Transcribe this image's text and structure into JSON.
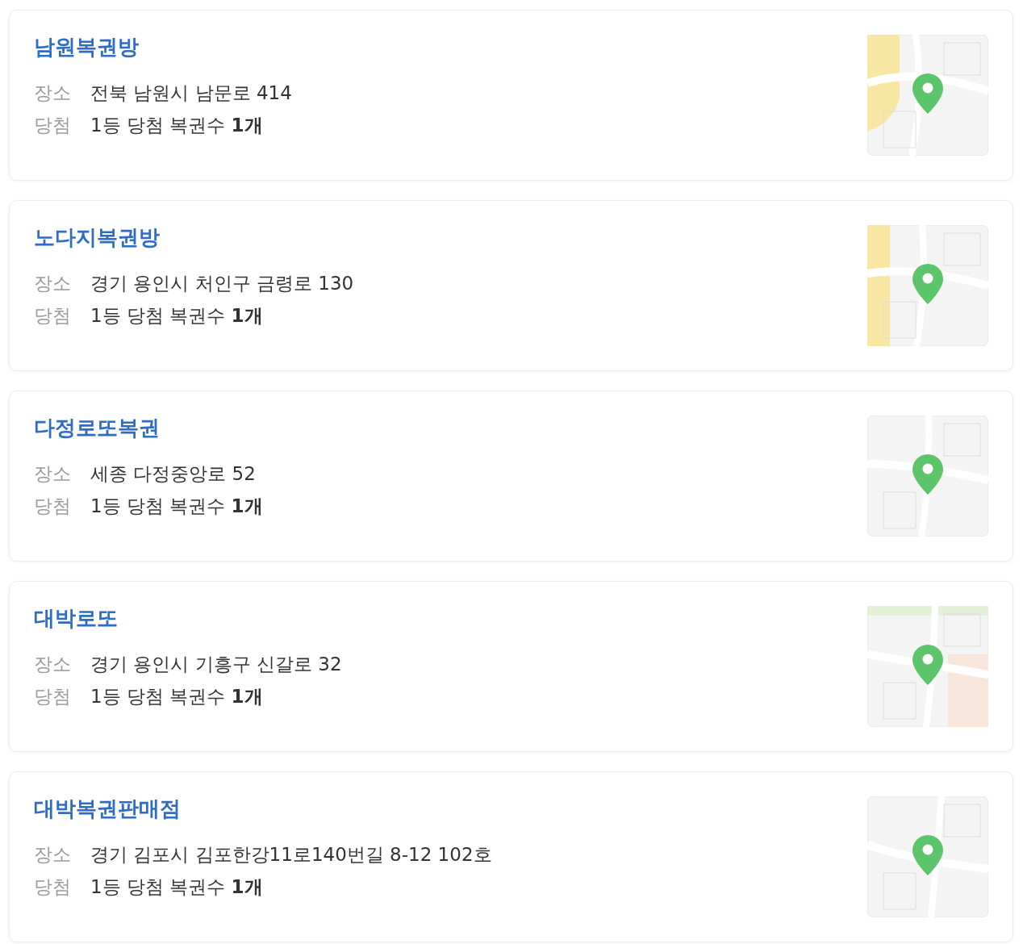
{
  "stores": [
    {
      "name": "남원복권방",
      "rows": [
        {
          "label": "장소",
          "value": "전북 남원시 남문로 414"
        },
        {
          "label": "당첨",
          "value": "1등 당첨 복권수 **1개**"
        }
      ]
    },
    {
      "name": "노다지복권방",
      "rows": [
        {
          "label": "장소",
          "value": "경기 용인시 처인구 금령로 130"
        },
        {
          "label": "당첨",
          "value": "1등 당첨 복권수 **1개**"
        }
      ]
    },
    {
      "name": "다정로또복권",
      "rows": [
        {
          "label": "장소",
          "value": "세종 다정중앙로 52"
        },
        {
          "label": "당첨",
          "value": "1등 당첨 복권수 **1개**"
        }
      ]
    },
    {
      "name": "대박로또",
      "rows": [
        {
          "label": "장소",
          "value": "경기 용인시 기흥구 신갈로 32"
        },
        {
          "label": "당첨",
          "value": "1등 당첨 복권수 **1개**"
        }
      ]
    },
    {
      "name": "대박복권판매점",
      "rows": [
        {
          "label": "장소",
          "value": "경기 김포시 김포한강11로140번길 8-12 102호"
        },
        {
          "label": "당첨",
          "value": "1등 당첨 복권수 **1개**"
        }
      ]
    }
  ]
}
